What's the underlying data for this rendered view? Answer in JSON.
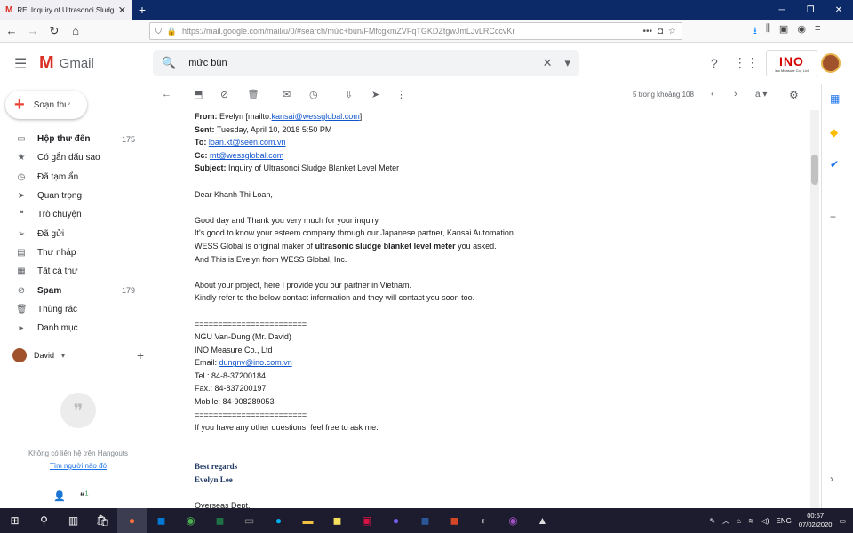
{
  "browser": {
    "tab_title": "RE: Inquiry of Ultrasonci Sludge",
    "url": "https://mail.google.com/mail/u/0/#search/mức+bùn/FMfcgxmZVFqTGKDZtgwJmLJvLRCccvKr"
  },
  "gmail": {
    "app_name": "Gmail",
    "search_query": "mức bùn",
    "compose_label": "Soạn thư",
    "org_logo": "INO",
    "org_logo_sub": "Ino Measure Co., Ltd"
  },
  "sidebar": {
    "items": [
      {
        "label": "Hộp thư đến",
        "count": "175",
        "icon": "inbox-icon"
      },
      {
        "label": "Có gắn dấu sao",
        "count": "",
        "icon": "star-icon"
      },
      {
        "label": "Đã tạm ẩn",
        "count": "",
        "icon": "clock-icon"
      },
      {
        "label": "Quan trọng",
        "count": "",
        "icon": "important-icon"
      },
      {
        "label": "Trò chuyện",
        "count": "",
        "icon": "chat-icon"
      },
      {
        "label": "Đã gửi",
        "count": "",
        "icon": "send-icon"
      },
      {
        "label": "Thư nháp",
        "count": "",
        "icon": "draft-icon"
      },
      {
        "label": "Tất cả thư",
        "count": "",
        "icon": "all-mail-icon"
      },
      {
        "label": "Spam",
        "count": "179",
        "icon": "spam-icon"
      },
      {
        "label": "Thùng rác",
        "count": "",
        "icon": "trash-icon"
      },
      {
        "label": "Danh mục",
        "count": "",
        "icon": "label-icon"
      }
    ],
    "hangouts_user": "David",
    "hangouts_empty": "Không có liên hệ trên Hangouts",
    "hangouts_link": "Tìm người nào đó",
    "hangouts_badge": "1"
  },
  "toolbar": {
    "pager": "5 trong khoảng 108"
  },
  "email": {
    "from_label": "From:",
    "from_value": "Evelyn [mailto:",
    "from_email": "kansai@wessglobal.com",
    "sent_label": "Sent:",
    "sent_value": "Tuesday, April 10, 2018 5:50 PM",
    "to_label": "To:",
    "to_email": "loan.kt@seen.com.vn",
    "cc_label": "Cc:",
    "cc_email": "mt@wessglobal.com",
    "subject_label": "Subject:",
    "subject_value": "Inquiry of Ultrasonci Sludge Blanket Level Meter",
    "greeting": "Dear Khanh Thi Loan,",
    "p1": "Good day and Thank you very much for your inquiry.",
    "p2": "It's good to know your esteem company through our Japanese partner, Kansai Automation.",
    "p3_a": "WESS Global is original maker of ",
    "p3_b": "ultrasonic sludge blanket level meter",
    "p3_c": " you asked.",
    "p4": "And This is Evelyn from WESS Global, Inc.",
    "p5": "About your project, here I provide you our partner in Vietnam.",
    "p6": "Kindly refer to the below contact information and they will contact you soon too.",
    "sep": "========================",
    "c_name": "NGU Van-Dung (Mr. David)",
    "c_company": "INO Measure Co., Ltd",
    "c_email_label": "Email: ",
    "c_email": "dungnv@ino.com.vn",
    "c_tel": "Tel.: 84-8-37200184",
    "c_fax": "Fax.: 84-837200197",
    "c_mobile": "Mobile: 84-908289053",
    "closing": "If you have any other questions, feel free to ask me.",
    "regards": "Best regards",
    "sig_name": "Evelyn Lee",
    "sig_dept": "Overseas Dept."
  },
  "taskbar": {
    "lang": "ENG",
    "time": "00:57",
    "date": "07/02/2020"
  }
}
